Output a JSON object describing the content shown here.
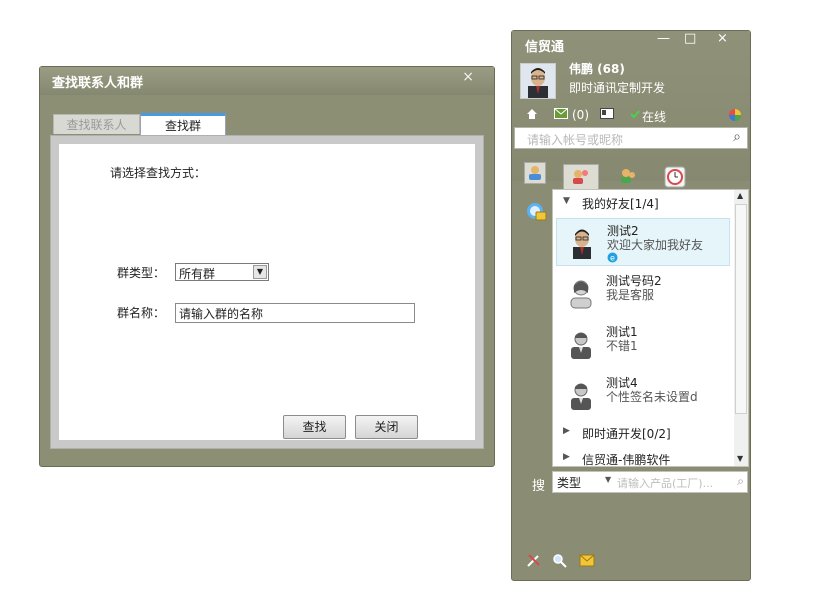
{
  "find_dialog": {
    "title": "查找联系人和群",
    "close_glyph": "×",
    "tabs": [
      "查找联系人",
      "查找群"
    ],
    "prompt": "请选择查找方式：",
    "group_type_label": "群类型：",
    "group_type_value": "所有群",
    "group_name_label": "群名称：",
    "group_name_value": "请输入群的名称",
    "search_button": "查找",
    "close_button": "关闭"
  },
  "im_panel": {
    "title": "信贸通",
    "window_buttons": [
      "—",
      "□",
      "×"
    ],
    "user_name": "伟鹏 (68)",
    "signature": "即时通讯定制开发",
    "mail_count": "(0)",
    "status": "在线",
    "search_placeholder": "请输入帐号或昵称",
    "groups": [
      {
        "name": "我的好友[1/4]",
        "expanded": true
      },
      {
        "name": "即时通开发[0/2]",
        "expanded": false
      },
      {
        "name": "信贸通-伟鹏软件",
        "expanded": false
      }
    ],
    "friends": [
      {
        "name": "测试2",
        "signature": "欢迎大家加我好友",
        "online": true
      },
      {
        "name": "测试号码2",
        "signature": "我是客服",
        "online": false
      },
      {
        "name": "测试1",
        "signature": "不错1",
        "online": false
      },
      {
        "name": "测试4",
        "signature": "个性签名未设置d",
        "online": false
      }
    ],
    "bottom_search": {
      "label": "搜",
      "type_label": "类型",
      "placeholder": "请输入产品(工厂)..."
    }
  },
  "colors": {
    "panel_bg": "#8a8d74",
    "tab_accent": "#4a9ae0",
    "selected_row": "#e6f5fa"
  }
}
